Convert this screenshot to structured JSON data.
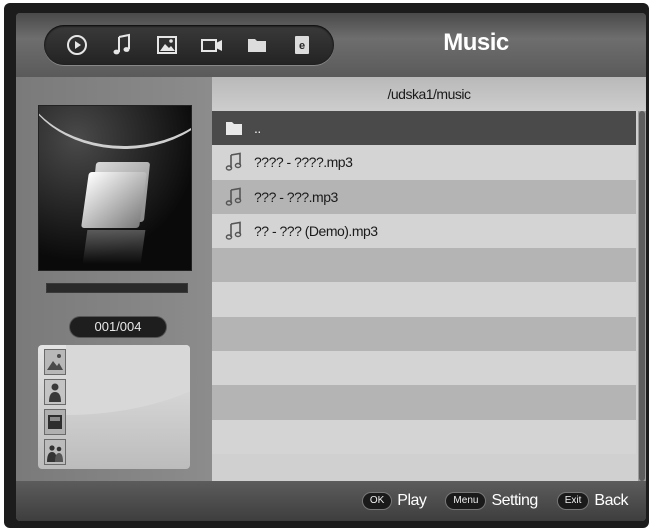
{
  "header": {
    "title": "Music",
    "nav_icons": [
      {
        "name": "play-circle-icon"
      },
      {
        "name": "music-note-icon"
      },
      {
        "name": "photo-icon"
      },
      {
        "name": "video-camera-icon"
      },
      {
        "name": "folder-icon"
      },
      {
        "name": "e-book-icon"
      }
    ]
  },
  "left_panel": {
    "album_art_icon": "folder-icon",
    "progress": 1.0,
    "counter": "001/004",
    "thumbnails": [
      "photo-icon",
      "person-icon",
      "drive-icon",
      "people-icon"
    ]
  },
  "browser": {
    "path": "/udska1/music",
    "files": [
      {
        "icon": "folder-icon",
        "label": "..",
        "selected": true
      },
      {
        "icon": "music-note-icon",
        "label": "???? - ????.mp3",
        "selected": false
      },
      {
        "icon": "music-note-icon",
        "label": "??? - ???.mp3",
        "selected": false
      },
      {
        "icon": "music-note-icon",
        "label": "?? - ??? (Demo).mp3",
        "selected": false
      },
      {
        "icon": "",
        "label": "",
        "selected": false
      },
      {
        "icon": "",
        "label": "",
        "selected": false
      },
      {
        "icon": "",
        "label": "",
        "selected": false
      },
      {
        "icon": "",
        "label": "",
        "selected": false
      },
      {
        "icon": "",
        "label": "",
        "selected": false
      },
      {
        "icon": "",
        "label": "",
        "selected": false
      }
    ]
  },
  "footer": {
    "hints": [
      {
        "key": "OK",
        "label": "Play"
      },
      {
        "key": "Menu",
        "label": "Setting"
      },
      {
        "key": "Exit",
        "label": "Back"
      }
    ]
  },
  "colors": {
    "selected_row": "#4a4a4a",
    "row_light": "#d4d4d4",
    "row_dark": "#b4b4b4",
    "title_text": "#ffffff"
  }
}
